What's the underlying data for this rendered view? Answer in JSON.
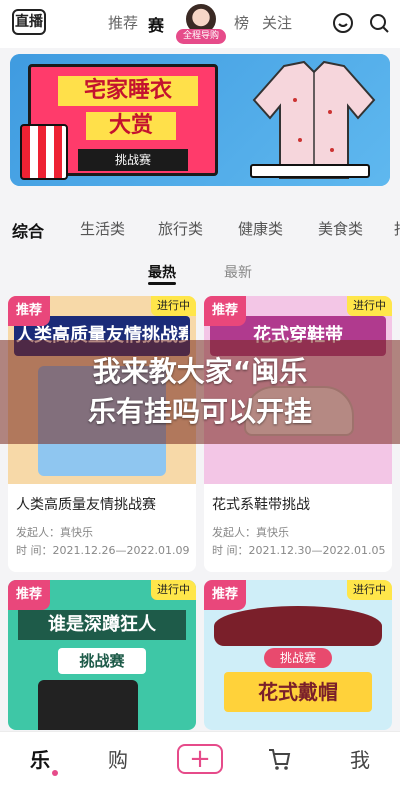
{
  "header": {
    "logo": "直播",
    "nav": [
      "推荐",
      "赛",
      "榜",
      "关注"
    ],
    "guide_label": "全程导购",
    "icons": [
      "smile-icon",
      "search-icon"
    ]
  },
  "banner": {
    "title_line1": "宅家睡衣",
    "title_line2": "大赏",
    "badge": "挑战赛"
  },
  "categories": [
    "综合",
    "生活类",
    "旅行类",
    "健康类",
    "美食类",
    "报"
  ],
  "sorts": [
    "最热",
    "最新"
  ],
  "cards": [
    {
      "tag_left": "推荐",
      "tag_right": "进行中",
      "image_caption": "人类高质量友情挑战赛",
      "title": "人类高质量友情挑战赛",
      "initiator_label": "发起人：",
      "initiator": "真快乐",
      "time_label": "时  间：",
      "time": "2021.12.26—2022.01.09"
    },
    {
      "tag_left": "推荐",
      "tag_right": "进行中",
      "image_caption": "花式穿鞋带",
      "title": "花式系鞋带挑战",
      "initiator_label": "发起人：",
      "initiator": "真快乐",
      "time_label": "时  间：",
      "time": "2021.12.30—2022.01.05"
    },
    {
      "tag_left": "推荐",
      "tag_right": "进行中",
      "image_caption": "谁是深蹲狂人",
      "image_badge": "挑战赛"
    },
    {
      "tag_left": "推荐",
      "tag_right": "进行中",
      "image_caption": "花式戴帽",
      "image_badge": "挑战赛"
    }
  ],
  "overlay": {
    "line1": "我来教大家“闽乐",
    "line2": "乐有挂吗可以开挂"
  },
  "tabbar": [
    "乐",
    "购",
    "+",
    "",
    "我"
  ]
}
